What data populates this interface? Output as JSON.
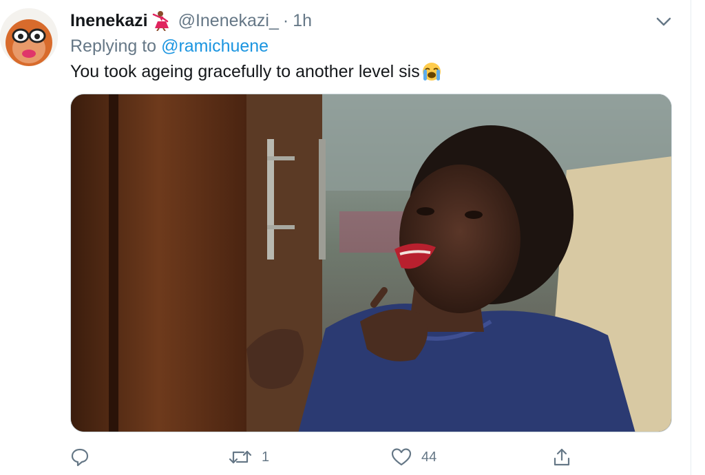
{
  "tweet": {
    "display_name": "Inenekazi",
    "handle": "@Inenekazi_",
    "separator": "·",
    "time": "1h",
    "reply_prefix": "Replying to",
    "reply_handle": "@ramichuene",
    "text": "You took ageing gracefully to another level sis"
  },
  "icons": {
    "name_emoji": "woman-dancing-emoji",
    "text_emoji": "loudly-crying-face-emoji",
    "caret": "chevron-down-icon"
  },
  "actions": {
    "reply_count": "",
    "retweet_count": "1",
    "like_count": "44"
  },
  "colors": {
    "primary_text": "#14171a",
    "secondary_text": "#657786",
    "link": "#1b95e0",
    "border": "#e6ecf0"
  }
}
